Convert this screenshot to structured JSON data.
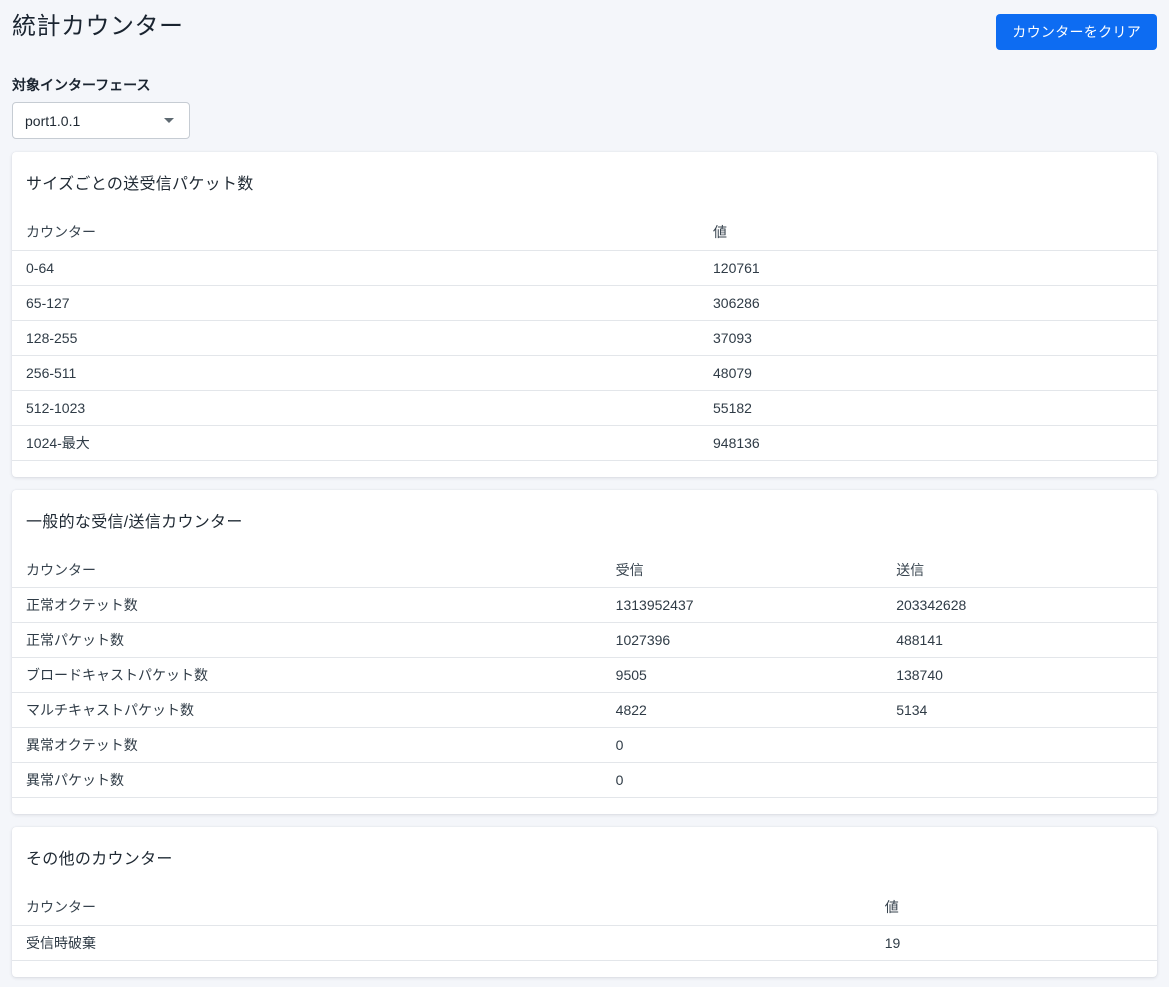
{
  "page": {
    "title": "統計カウンター",
    "clear_button_label": "カウンターをクリア"
  },
  "interface_selector": {
    "label": "対象インターフェース",
    "value": "port1.0.1"
  },
  "cards": [
    {
      "title": "サイズごとの送受信パケット数",
      "columns": [
        "カウンター",
        "値"
      ],
      "rows": [
        [
          "0-64",
          "120761"
        ],
        [
          "65-127",
          "306286"
        ],
        [
          "128-255",
          "37093"
        ],
        [
          "256-511",
          "48079"
        ],
        [
          "512-1023",
          "55182"
        ],
        [
          "1024-最大",
          "948136"
        ]
      ]
    },
    {
      "title": "一般的な受信/送信カウンター",
      "columns": [
        "カウンター",
        "受信",
        "送信"
      ],
      "rows": [
        [
          "正常オクテット数",
          "1313952437",
          "203342628"
        ],
        [
          "正常パケット数",
          "1027396",
          "488141"
        ],
        [
          "ブロードキャストパケット数",
          "9505",
          "138740"
        ],
        [
          "マルチキャストパケット数",
          "4822",
          "5134"
        ],
        [
          "異常オクテット数",
          "0",
          ""
        ],
        [
          "異常パケット数",
          "0",
          ""
        ]
      ]
    },
    {
      "title": "その他のカウンター",
      "columns": [
        "カウンター",
        "値"
      ],
      "rows": [
        [
          "受信時破棄",
          "19"
        ]
      ]
    }
  ],
  "colors": {
    "accent": "#0d6cf2",
    "page_background": "#f4f6fa",
    "card_background": "#ffffff",
    "divider": "#e3e6ea",
    "text_primary": "#222b36"
  }
}
